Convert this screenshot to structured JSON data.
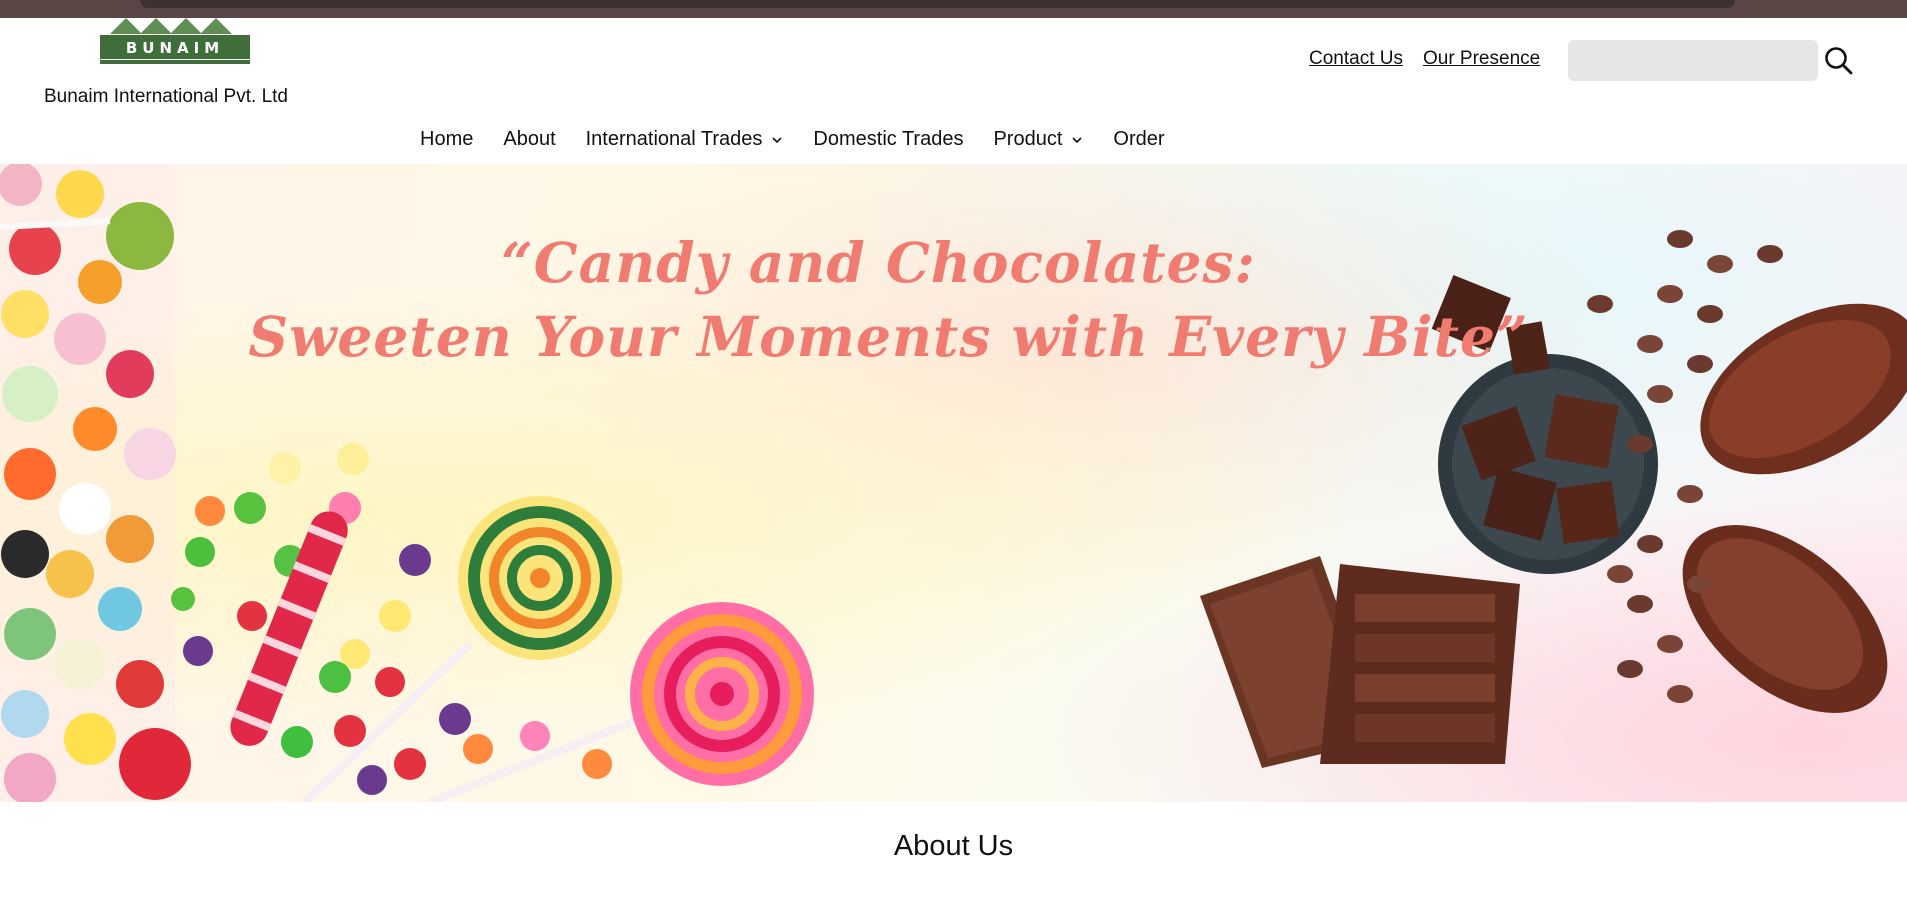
{
  "brand": {
    "logo_text": "BUNAIM",
    "company_name": "Bunaim International Pvt. Ltd"
  },
  "top_links": {
    "contact": "Contact Us",
    "presence": "Our Presence"
  },
  "search": {
    "placeholder": "",
    "value": "",
    "icon": "search-icon"
  },
  "nav": {
    "home": "Home",
    "about": "About",
    "international": "International Trades",
    "domestic": "Domestic Trades",
    "product": "Product",
    "order": "Order"
  },
  "hero": {
    "line1": "“Candy and Chocolates:",
    "line2": "Sweeten Your Moments with Every Bite”"
  },
  "about": {
    "heading": "About Us"
  },
  "colors": {
    "hero_text": "#f07b70",
    "logo_green": "#3f6e3a",
    "browser_bar": "#5a4644"
  }
}
